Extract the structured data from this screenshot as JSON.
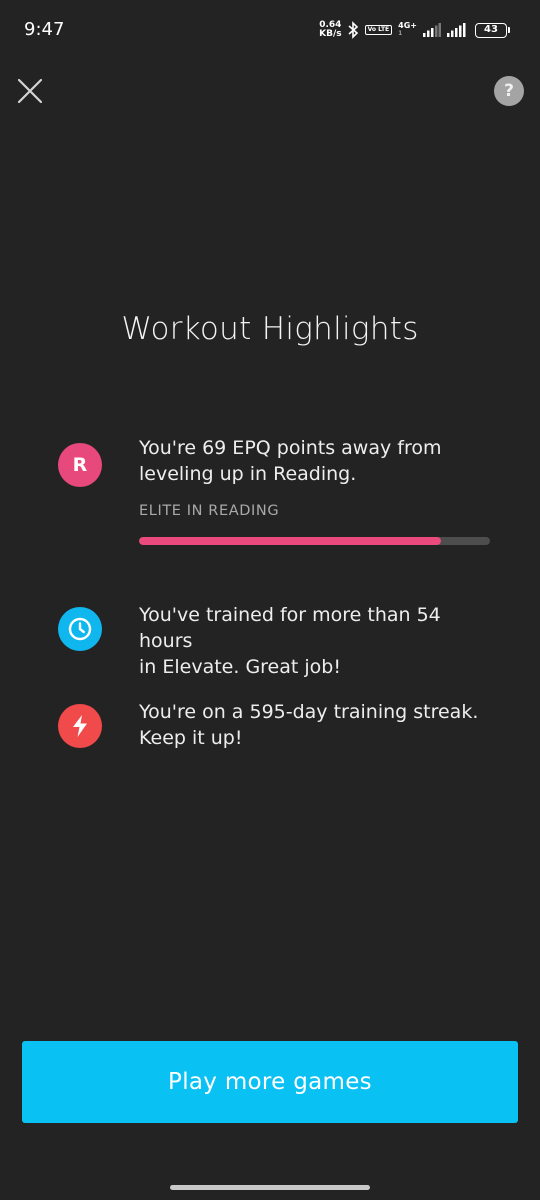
{
  "status_bar": {
    "time": "9:47",
    "net_speed_value": "0.64",
    "net_speed_unit": "KB/s",
    "volte_label": "Vo LTE",
    "network_type": "4G+",
    "network_sub": "1",
    "battery_level": "43"
  },
  "header": {
    "close_icon": "close-icon",
    "help_label": "?"
  },
  "title": "Workout Highlights",
  "highlights": [
    {
      "icon_letter": "R",
      "icon_color": "#e8497d",
      "text_line1": "You're 69 EPQ points away from",
      "text_line2": "leveling up in Reading.",
      "level_label": "ELITE IN READING",
      "progress_fraction": 0.86
    },
    {
      "icon": "clock-icon",
      "icon_color": "#10b7ee",
      "text_line1": "You've trained for more than 54 hours",
      "text_line2": "in Elevate. Great job!"
    },
    {
      "icon": "bolt-icon",
      "icon_color": "#f04a4a",
      "text_line1": "You're on a 595-day training streak.",
      "text_line2": "Keep it up!"
    }
  ],
  "cta": {
    "label": "Play more games",
    "color": "#0ac1f4"
  }
}
